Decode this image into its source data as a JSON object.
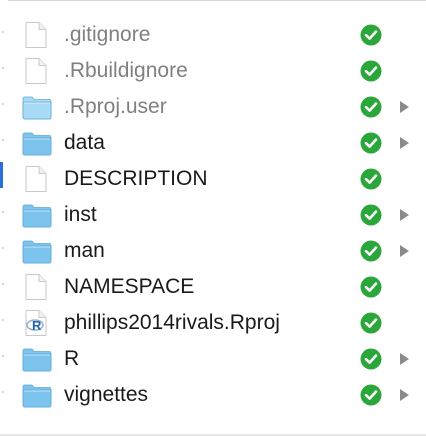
{
  "files": [
    {
      "name": ".gitignore",
      "kind": "document",
      "hidden": true,
      "status": "check-circle-icon",
      "expandable": false
    },
    {
      "name": ".Rbuildignore",
      "kind": "document",
      "hidden": true,
      "status": "check-circle-icon",
      "expandable": false
    },
    {
      "name": ".Rproj.user",
      "kind": "folder",
      "hidden": true,
      "status": "check-circle-icon",
      "expandable": true
    },
    {
      "name": "data",
      "kind": "folder",
      "hidden": false,
      "status": "check-circle-icon",
      "expandable": true
    },
    {
      "name": "DESCRIPTION",
      "kind": "document",
      "hidden": false,
      "status": "check-circle-icon",
      "expandable": false
    },
    {
      "name": "inst",
      "kind": "folder",
      "hidden": false,
      "status": "check-circle-icon",
      "expandable": true
    },
    {
      "name": "man",
      "kind": "folder",
      "hidden": false,
      "status": "check-circle-icon",
      "expandable": true
    },
    {
      "name": "NAMESPACE",
      "kind": "document",
      "hidden": false,
      "status": "check-circle-icon",
      "expandable": false
    },
    {
      "name": "phillips2014rivals.Rproj",
      "kind": "rproj",
      "hidden": false,
      "status": "check-circle-icon",
      "expandable": false
    },
    {
      "name": "R",
      "kind": "folder",
      "hidden": false,
      "status": "check-circle-icon",
      "expandable": true
    },
    {
      "name": "vignettes",
      "kind": "folder",
      "hidden": false,
      "status": "check-circle-icon",
      "expandable": true
    }
  ],
  "rproj_icon_letter": "R",
  "colors": {
    "folder": "#7cc4ee",
    "folder_light": "#a9dbf6",
    "check": "#2aa63a",
    "text": "#1a1a1a",
    "hidden_text": "#808080",
    "disclosure": "#8a8a8a",
    "selection": "#2b6fd6"
  }
}
